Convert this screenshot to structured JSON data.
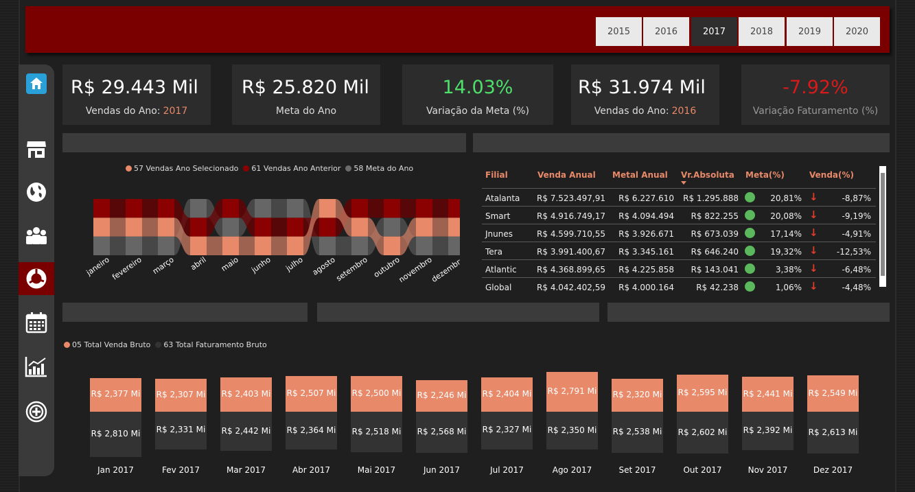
{
  "years": [
    "2015",
    "2016",
    "2017",
    "2018",
    "2019",
    "2020"
  ],
  "selected_year": "2017",
  "nav": [
    "home-icon",
    "store-icon",
    "globe-icon",
    "team-icon",
    "donut-chart-icon",
    "calendar-icon",
    "bar-chart-icon",
    "target-icon"
  ],
  "kpis": {
    "sales_year": {
      "value": "R$ 29.443 Mil",
      "label": "Vendas do Ano:",
      "year": "2017"
    },
    "goal_year": {
      "value": "R$ 25.820 Mil",
      "label": "Meta do Ano"
    },
    "goal_variation": {
      "value": "14.03%",
      "label": "Variação da Meta (%)",
      "color": "#4ee06a"
    },
    "sales_prev": {
      "value": "R$ 31.974 Mil",
      "label": "Vendas do Ano:",
      "year": "2016"
    },
    "revenue_variation": {
      "value": "-7.92%",
      "label": "Variação Faturamento (%)",
      "color": "#d91a1a"
    }
  },
  "ribbon_legend": [
    {
      "label": "57 Vendas Ano Selecionado",
      "color": "#e8896a"
    },
    {
      "label": "61 Vendas Ano Anterior",
      "color": "#8b0000"
    },
    {
      "label": "58 Meta do Ano",
      "color": "#6b6b6b"
    }
  ],
  "ribbon_months": [
    "janeiro",
    "fevereiro",
    "março",
    "abril",
    "maio",
    "junho",
    "julho",
    "agosto",
    "setembro",
    "outubro",
    "novembro",
    "dezembro"
  ],
  "table": {
    "headers": [
      "Filial",
      "Venda Anual",
      "Metal Anual",
      "Vr.Absoluta",
      "Meta(%)",
      "Venda(%)"
    ],
    "rows": [
      {
        "filial": "Atalanta",
        "venda": "R$ 7.523.497,91",
        "meta": "R$ 6.227.610",
        "abs": "R$ 1.295.888",
        "meta_pct": "20,81%",
        "venda_pct": "-8,87%"
      },
      {
        "filial": "Smart",
        "venda": "R$ 4.916.749,17",
        "meta": "R$ 4.094.494",
        "abs": "R$ 822.255",
        "meta_pct": "20,08%",
        "venda_pct": "-9,19%"
      },
      {
        "filial": "Jnunes",
        "venda": "R$ 4.599.710,55",
        "meta": "R$ 3.926.671",
        "abs": "R$ 673.039",
        "meta_pct": "17,14%",
        "venda_pct": "-4,91%"
      },
      {
        "filial": "Tera",
        "venda": "R$ 3.991.400,67",
        "meta": "R$ 3.345.161",
        "abs": "R$ 646.240",
        "meta_pct": "19,32%",
        "venda_pct": "-12,53%"
      },
      {
        "filial": "Atlantic",
        "venda": "R$ 4.368.899,65",
        "meta": "R$ 4.225.858",
        "abs": "R$ 143.041",
        "meta_pct": "3,38%",
        "venda_pct": "-6,48%"
      },
      {
        "filial": "Global",
        "venda": "R$ 4.042.402,59",
        "meta": "R$ 4.000.164",
        "abs": "R$ 42.238",
        "meta_pct": "1,06%",
        "venda_pct": "-4,48%"
      }
    ]
  },
  "bottom_legend": [
    {
      "label": "05 Total Venda Bruto",
      "color": "#e8896a"
    },
    {
      "label": "63 Total Faturamento Bruto",
      "color": "#333333"
    }
  ],
  "chart_data": {
    "type": "bar",
    "categories": [
      "Jan 2017",
      "Fev 2017",
      "Mar 2017",
      "Abr 2017",
      "Mai 2017",
      "Jun 2017",
      "Jul 2017",
      "Ago 2017",
      "Set 2017",
      "Out 2017",
      "Nov 2017",
      "Dez 2017"
    ],
    "series": [
      {
        "name": "05 Total Venda Bruto",
        "values": [
          2.377,
          2.307,
          2.403,
          2.507,
          2.5,
          2.246,
          2.404,
          2.791,
          2.32,
          2.595,
          2.441,
          2.549
        ],
        "labels": [
          "R$ 2,377 Mi",
          "R$ 2,307 Mi",
          "R$ 2,403 Mi",
          "R$ 2,507 Mi",
          "R$ 2,500 Mi",
          "R$ 2,246 Mi",
          "R$ 2,404 Mi",
          "R$ 2,791 Mi",
          "R$ 2,320 Mi",
          "R$ 2,595 Mi",
          "R$ 2,441 Mi",
          "R$ 2,549 Mi"
        ],
        "color": "#e8896a"
      },
      {
        "name": "63 Total Faturamento Bruto",
        "values": [
          2.81,
          2.331,
          2.442,
          2.364,
          2.518,
          2.568,
          2.327,
          2.35,
          2.538,
          2.602,
          2.392,
          2.613
        ],
        "labels": [
          "R$ 2,810 Mi",
          "R$ 2,331 Mi",
          "R$ 2,442 Mi",
          "R$ 2,364 Mi",
          "R$ 2,518 Mi",
          "R$ 2,568 Mi",
          "R$ 2,327 Mi",
          "R$ 2,350 Mi",
          "R$ 2,538 Mi",
          "R$ 2,602 Mi",
          "R$ 2,392 Mi",
          "R$ 2,613 Mi"
        ],
        "color": "#333333"
      }
    ]
  }
}
